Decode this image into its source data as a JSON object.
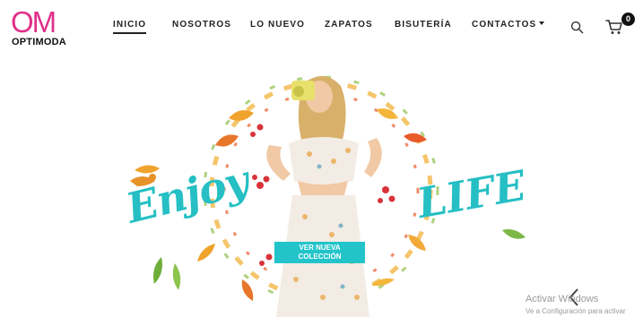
{
  "brand": {
    "mark": "OM",
    "name": "OPTIMODA",
    "color": "#e0308a"
  },
  "nav": {
    "items": [
      {
        "label": "INICIO",
        "active": true
      },
      {
        "label": "NOSOTROS",
        "active": false
      },
      {
        "label": "LO NUEVO",
        "active": false
      },
      {
        "label": "ZAPATOS",
        "active": false
      },
      {
        "label": "BISUTERÍA",
        "active": false
      },
      {
        "label": "CONTACTOS",
        "active": false,
        "dropdown": true
      }
    ]
  },
  "header_icons": {
    "search": "search-icon",
    "cart": "cart-icon",
    "cart_count": "0"
  },
  "hero": {
    "headline_left": "Enjoy",
    "headline_right": "LIFE",
    "cta_line1": "VER NUEVA",
    "cta_line2": "COLECCIÓN",
    "accent": "#22c4c9"
  },
  "overlay": {
    "activate_title": "Activar Windows",
    "activate_sub": "Ve a Configuración para activar"
  }
}
